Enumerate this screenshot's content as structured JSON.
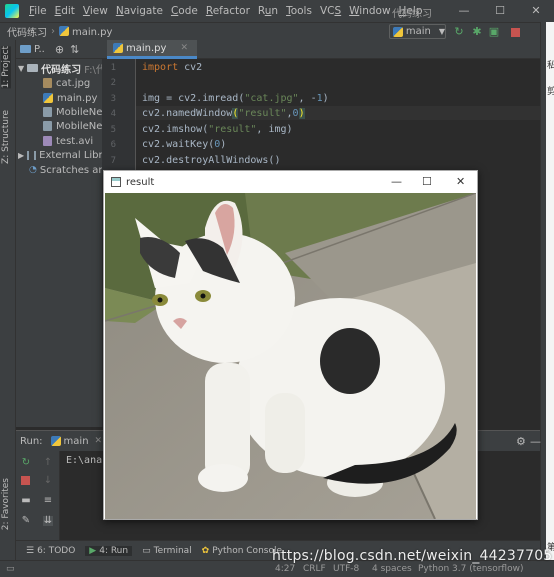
{
  "window": {
    "title": "代码练习",
    "menu": [
      {
        "label": "File",
        "mnemonic": "F"
      },
      {
        "label": "Edit",
        "mnemonic": "E"
      },
      {
        "label": "View",
        "mnemonic": "V"
      },
      {
        "label": "Navigate",
        "mnemonic": "N"
      },
      {
        "label": "Code",
        "mnemonic": "C"
      },
      {
        "label": "Refactor",
        "mnemonic": "R"
      },
      {
        "label": "Run",
        "mnemonic": "u"
      },
      {
        "label": "Tools",
        "mnemonic": "T"
      },
      {
        "label": "VCS",
        "mnemonic": "S"
      },
      {
        "label": "Window",
        "mnemonic": "W"
      },
      {
        "label": "Help",
        "mnemonic": "H"
      }
    ],
    "controls": {
      "minimize": "—",
      "maximize": "☐",
      "close": "✕"
    }
  },
  "navbar": {
    "project": "代码练习",
    "file": "main.py",
    "run_config": "main"
  },
  "side_tabs": {
    "project": "1: Project",
    "structure": "Z: Structure",
    "favorites": "2: Favorites"
  },
  "project_panel": {
    "header_label": "P..",
    "root": {
      "name": "代码练习",
      "path": "F:\\代"
    },
    "files": [
      "cat.jpg",
      "main.py",
      "MobileNet",
      "MobileNet",
      "test.avi"
    ],
    "external": "External Librar",
    "scratches": "Scratches and"
  },
  "editor": {
    "tab_label": "main.py",
    "line_numbers": [
      "1",
      "2",
      "3",
      "4",
      "5",
      "6",
      "7"
    ]
  },
  "run_panel": {
    "label": "Run:",
    "config": "main",
    "output": "E:\\anac"
  },
  "bottom_tabs": [
    {
      "label": "6: TODO"
    },
    {
      "label": "4: Run"
    },
    {
      "label": "Terminal"
    },
    {
      "label": "Python Console"
    }
  ],
  "status_bar": {
    "position": "4:27",
    "line_sep": "CRLF",
    "encoding": "UTF-8",
    "indent": "4 spaces",
    "interpreter": "Python 3.7 (tensorflow)"
  },
  "right_side": {
    "chars": [
      "私",
      "剪",
      "第"
    ]
  },
  "cv_window": {
    "title": "result",
    "controls": {
      "minimize": "—",
      "maximize": "☐",
      "close": "✕"
    }
  },
  "watermark": "https://blog.csdn.net/weixin_44237705"
}
